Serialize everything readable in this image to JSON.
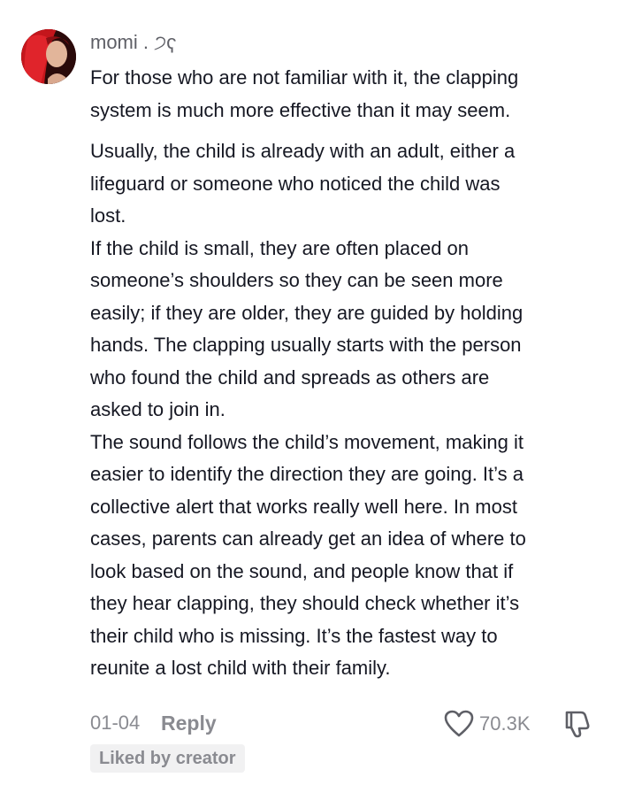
{
  "comment": {
    "username": "momi . ੭ҁ",
    "paragraphs": [
      "For those who are not familiar with it, the clapping\nsystem is much more effective than it may seem.",
      "Usually, the child is already with an adult, either a\nlifeguard or someone who noticed the child was\nlost.\nIf the child is small, they are often placed on\nsomeone’s shoulders so they can be seen more\neasily; if they are older, they are guided by holding\nhands. The clapping usually starts with the person\nwho found the child and spreads as others are\nasked to join in.\nThe sound follows the child’s movement, making it\neasier to identify the direction they are going. It’s a\ncollective alert that works really well here. In most\ncases, parents can already get an idea of where to\nlook based on the sound, and people know that if\nthey hear clapping, they should check whether it’s\ntheir child who is missing. It’s the fastest way to\nreunite a lost child with their family."
    ],
    "date": "01-04",
    "reply_label": "Reply",
    "like_count": "70.3K",
    "liked_by_creator": "Liked by creator"
  },
  "icons": {
    "like": "heart-outline-icon",
    "dislike": "thumbs-down-icon",
    "avatar": "user-avatar"
  },
  "colors": {
    "text": "#161823",
    "muted": "#8a8b91",
    "badge_bg": "#f1f1f2"
  }
}
